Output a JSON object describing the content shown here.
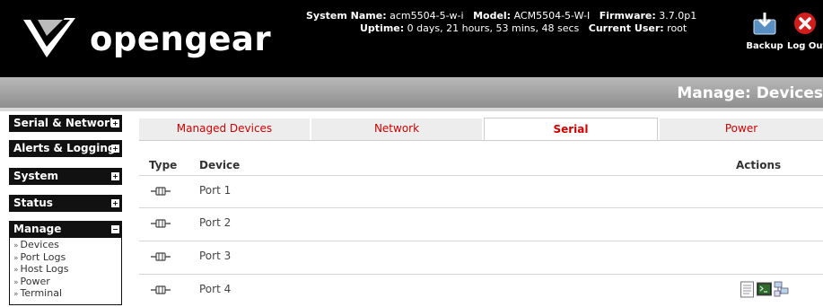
{
  "header": {
    "logo_text": "opengear",
    "system_name_label": "System Name:",
    "system_name": "acm5504-5-w-i",
    "model_label": "Model:",
    "model": "ACM5504-5-W-I",
    "firmware_label": "Firmware:",
    "firmware": "3.7.0p1",
    "uptime_label": "Uptime:",
    "uptime": "0 days, 21 hours, 53 mins, 48 secs",
    "current_user_label": "Current User:",
    "current_user": "root",
    "backup_label": "Backup",
    "logout_label": "Log Out"
  },
  "page_title": "Manage: Devices",
  "sidebar": {
    "sections": [
      {
        "label": "Serial & Network",
        "state": "collapsed"
      },
      {
        "label": "Alerts & Logging",
        "state": "collapsed"
      },
      {
        "label": "System",
        "state": "collapsed"
      },
      {
        "label": "Status",
        "state": "collapsed"
      },
      {
        "label": "Manage",
        "state": "expanded"
      }
    ],
    "manage_items": [
      "Devices",
      "Port Logs",
      "Host Logs",
      "Power",
      "Terminal"
    ]
  },
  "tabs": [
    {
      "label": "Managed Devices",
      "active": false
    },
    {
      "label": "Network",
      "active": false
    },
    {
      "label": "Serial",
      "active": true
    },
    {
      "label": "Power",
      "active": false
    }
  ],
  "table": {
    "headers": {
      "type": "Type",
      "device": "Device",
      "actions": "Actions"
    },
    "rows": [
      {
        "device": "Port 1",
        "type_icon": "serial-port-icon"
      },
      {
        "device": "Port 2",
        "type_icon": "serial-port-icon"
      },
      {
        "device": "Port 3",
        "type_icon": "serial-port-icon"
      },
      {
        "device": "Port 4",
        "type_icon": "serial-port-icon",
        "actions": [
          "log-document-icon",
          "terminal-icon",
          "network-computers-icon"
        ]
      }
    ]
  },
  "colors": {
    "header_bg": "#000000",
    "tab_text": "#cc0000",
    "titlebar": "#9a9a9a"
  }
}
